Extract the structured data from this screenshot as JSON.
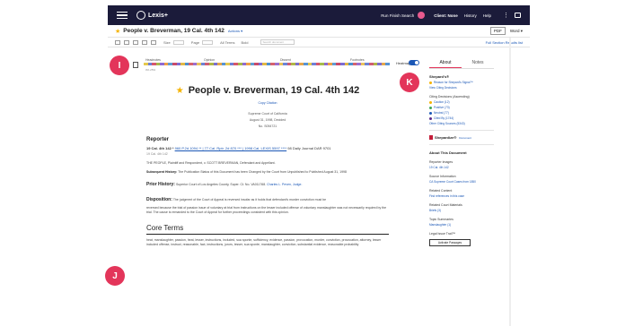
{
  "topbar": {
    "logo": "Lexis+",
    "run_search": "Run Finish Search",
    "links": [
      "Client: None",
      "History",
      "Help"
    ],
    "colors": {
      "background": "#1b1b3a",
      "avatar": "#e85a8e"
    }
  },
  "doc_header": {
    "title": "People v. Breverman, 19 Cal. 4th 142",
    "actions": "Actions ▾",
    "pdf": "PDF",
    "word": "Word ▾"
  },
  "toolbar": {
    "size_label": "Size",
    "page_label": "Page",
    "page_value": "Page 1",
    "all_terms_label": "All Terms",
    "all_terms_value": "Bold",
    "search_placeholder": "Search document",
    "right": "Full Section  Results list"
  },
  "heatmap": {
    "labels": [
      "Headnotes",
      "Opinion",
      "Dissent",
      "Footnotes"
    ],
    "small_label": "0%  25%",
    "toggle_label": "Heatmap",
    "toggle_on": true,
    "colors": [
      "#e6c94d",
      "#6f7fd6",
      "#d7566b",
      "#a7b94a",
      "#8f6ad1",
      "#efa045",
      "#5f9dd4",
      "#c84a6a",
      "#7c6cd3",
      "#e3b843",
      "#4b8fd0",
      "#d6626d",
      "#9b6fcf",
      "#eac35a",
      "#6a84d7",
      "#cf5d72",
      "#b0b746",
      "#7a6fd0",
      "#e5a64b",
      "#5693d5"
    ]
  },
  "badges": {
    "i": "I",
    "j": "J",
    "k": "K",
    "color": "#e3355a"
  },
  "document": {
    "title": "People v. Breverman, 19 Cal. 4th 142",
    "copy_citation": "Copy Citation",
    "court": "Supreme Court of California",
    "date": "August 31, 1998, Decided",
    "docket": "No. S054721",
    "reporter_heading": "Reporter",
    "reporter_prefix": "19 Cal. 4th 142 *",
    "reporter_links": "960 P.2d 1094 ** | 77 Cal. Rptr. 2d 870 *** | 1998 Cal. LEXIS 5597 ****",
    "reporter_tail": "98 Daily Journal DAR 9701",
    "reporter_sub": "19 Cal. 4th 142",
    "party": "THE PEOPLE, Plaintiff and Respondent, v. SCOTT BREVERMAN, Defendant and Appellant.",
    "history_label": "Subsequent History:",
    "history_text": "The Publication Status of this Document has been Changed by the Court from Unpublished to Published August 31, 1998",
    "prior_label": "Prior History:",
    "prior_text": "Superior Court of Los Angeles County, Super. Ct. No. VA011768.",
    "prior_link": "Charles L. Peven, Judge.",
    "disposition_label": "Disposition:",
    "disposition_text": "The judgment of the Court of Appeal is reversed insofar as it holds that defendant's murder conviction must be",
    "disposition_more": "reversed because the trial of passion issue of voluntary at trial from instructions on the lesser included offense of voluntary manslaughter was not necessarily required by the trial. The cause is remanded to the Court of Appeal for further proceedings consistent with this opinion.",
    "core_terms_heading": "Core Terms",
    "core_terms_text": "heat, manslaughter, passion, heat, lesser, instructions, included, sua sponte, sufficiency, evidence, passion, provocation, murder, conviction, provocation, attorney, lesser included offense, instruct, reasonable, fact, instructions, jurors, lesser, sua sponte, manslaughter, conviction, substantial evidence, reasonable probability"
  },
  "right_panel": {
    "tabs": [
      "About",
      "Notes"
    ],
    "shepards_in": "Shepard's®",
    "reason_label": "Reason for Shepard's Signal™",
    "reason_link": "View Citing Decisions",
    "citing_analysis": "Citing Decisions (Ascending)",
    "citing_items": [
      "Caution (12)",
      "Positive (73)",
      "Neutral (77)",
      "Cited By (1744)"
    ],
    "citing_colors": [
      "#f5b300",
      "#3aa655",
      "#1a57b6",
      "#5a2a8a"
    ],
    "other_citing": "Other Citing Sources (5343)",
    "shepardize": "Shepardize®",
    "shepardize_link": "Document",
    "about_heading": "About This Document",
    "reporter_images": "Reporter Images",
    "reporter_images_link": "19 Cal. 4th 142",
    "source_info": "Source Information",
    "source_link": "CA Supreme Court Cases from 1850",
    "related": "Related Content",
    "related_link": "Find references in this case",
    "related_court": "Related Court Materials",
    "related_court_link": "Briefs (3)",
    "topic_summaries": "Topic Summaries",
    "topic_link": "Manslaughter (1)",
    "legal_issue": "Legal Issue Trail™",
    "activate": "Activate Passages"
  }
}
